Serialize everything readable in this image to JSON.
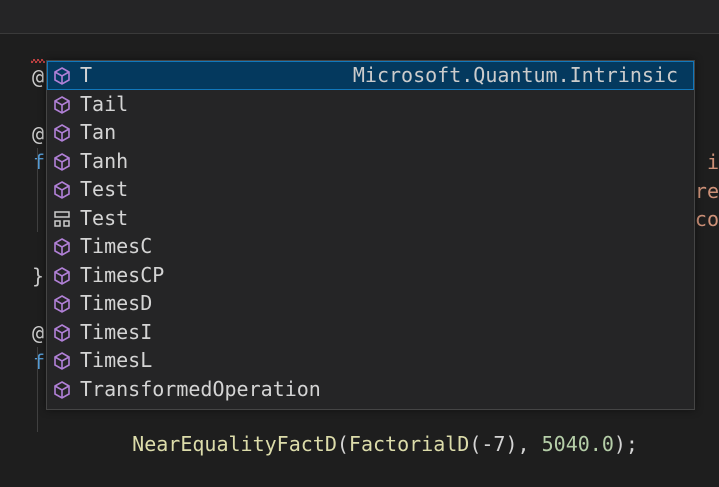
{
  "editor": {
    "line1_marker": "@",
    "marker_lines": [
      "@",
      "@"
    ],
    "function_lines": [
      "f",
      "f"
    ],
    "closing_brace": "}",
    "right_clip_lines": [
      "i",
      "re",
      "co"
    ],
    "bottom_line": {
      "name": "NearEqualityFactD",
      "arg_open": "(",
      "call": "FactorialD",
      "arg": "(-7)",
      "sep": ", ",
      "value": "5040.0",
      "end": ");"
    }
  },
  "suggestions": {
    "selected_index": 0,
    "items": [
      {
        "label": "T",
        "detail": "Microsoft.Quantum.Intrinsic",
        "icon": "cube-icon"
      },
      {
        "label": "Tail",
        "icon": "cube-icon"
      },
      {
        "label": "Tan",
        "icon": "cube-icon"
      },
      {
        "label": "Tanh",
        "icon": "cube-icon"
      },
      {
        "label": "Test",
        "icon": "cube-icon"
      },
      {
        "label": "Test",
        "icon": "structure-icon"
      },
      {
        "label": "TimesC",
        "icon": "cube-icon"
      },
      {
        "label": "TimesCP",
        "icon": "cube-icon"
      },
      {
        "label": "TimesD",
        "icon": "cube-icon"
      },
      {
        "label": "TimesI",
        "icon": "cube-icon"
      },
      {
        "label": "TimesL",
        "icon": "cube-icon"
      },
      {
        "label": "TransformedOperation",
        "icon": "cube-icon"
      }
    ]
  },
  "colors": {
    "background": "#1e1e1e",
    "widget": "#252526",
    "selection": "#04395e",
    "icon": "#b180d7",
    "keyword": "#569cd6",
    "string": "#ce9178"
  }
}
